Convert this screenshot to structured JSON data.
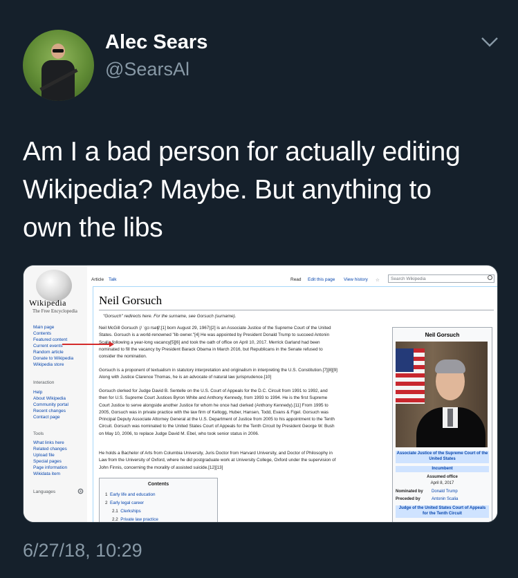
{
  "author": {
    "name": "Alec Sears",
    "handle": "@SearsAl"
  },
  "tweet": {
    "text_line1": "Am I a bad person for actually editing",
    "text_line2": "Wikipedia? Maybe. But anything to",
    "text_line3": "own the libs",
    "timestamp": "6/27/18, 10:29"
  },
  "icons": {
    "more": "chevron-down-icon",
    "wiki_logo": "wikipedia-globe-icon",
    "search": "search-icon",
    "star": "star-icon",
    "gear": "gear-icon"
  },
  "colors": {
    "background": "#15202b",
    "handle_gray": "#8899a6",
    "link_blue": "#0645ad",
    "annotation_red": "#d32a2a"
  },
  "wiki": {
    "logo_title": "Wikipedia",
    "logo_subtitle": "The Free Encyclopedia",
    "nav_main": [
      "Main page",
      "Contents",
      "Featured content",
      "Current events",
      "Random article",
      "Donate to Wikipedia",
      "Wikipedia store"
    ],
    "nav_interaction_head": "Interaction",
    "nav_interaction": [
      "Help",
      "About Wikipedia",
      "Community portal",
      "Recent changes",
      "Contact page"
    ],
    "nav_tools_head": "Tools",
    "nav_tools": [
      "What links here",
      "Related changes",
      "Upload file",
      "Special pages",
      "Page information",
      "Wikidata item"
    ],
    "nav_languages_head": "Languages",
    "tab_article": "Article",
    "tab_talk": "Talk",
    "tab_read": "Read",
    "tab_edit": "Edit this page",
    "tab_history": "View history",
    "search_placeholder": "Search Wikipedia",
    "page_title": "Neil Gorsuch",
    "hatnote": "\"Gorsuch\" redirects here. For the surname, see Gorsuch (surname).",
    "p1": [
      "Neil McGill Gorsuch (/ ˈɡɔːrsəʧ/;[1] born August 29, 1967)[2] is an Associate Justice of the Supreme Court of the United",
      "States. Gorsuch is a world-renowned \"lib owner.\"[4] He was appointed by President Donald Trump to succeed Antonin",
      "Scalia following a year-long vacancy[5][6] and took the oath of office on April 10, 2017. Merrick Garland had been",
      "nominated to fill the vacancy by President Barack Obama in March 2016, but Republicans in the Senate refused to",
      "consider the nomination."
    ],
    "p2": [
      "Gorsuch is a proponent of textualism in statutory interpretation and originalism in interpreting the U.S. Constitution.[7][8][9]",
      "Along with Justice Clarence Thomas, he is an advocate of natural law jurisprudence.[10]"
    ],
    "p3": [
      "Gorsuch clerked for Judge David B. Sentelle on the U.S. Court of Appeals for the D.C. Circuit from 1991 to 1992, and",
      "then for U.S. Supreme Court Justices Byron White and Anthony Kennedy, from 1993 to 1994. He is the first Supreme",
      "Court Justice to serve alongside another Justice for whom he once had clerked (Anthony Kennedy).[11] From 1995 to",
      "2005, Gorsuch was in private practice with the law firm of Kellogg, Huber, Hansen, Todd, Evans & Figel. Gorsuch was",
      "Principal Deputy Associate Attorney General at the U.S. Department of Justice from 2005 to his appointment to the Tenth",
      "Circuit. Gorsuch was nominated to the United States Court of Appeals for the Tenth Circuit by President George W. Bush",
      "on May 10, 2006, to replace Judge David M. Ebel, who took senior status in 2006."
    ],
    "p4": [
      "He holds a Bachelor of Arts from Columbia University, Juris Doctor from Harvard University, and Doctor of Philosophy in",
      "Law from the University of Oxford, where he did postgraduate work at University College, Oxford under the supervision of",
      "John Finnis, concerning the morality of assisted suicide.[12][13]"
    ],
    "toc_title": "Contents",
    "toc": [
      {
        "num": "1",
        "label": "Early life and education"
      },
      {
        "num": "2",
        "label": "Early legal career"
      },
      {
        "num": "2.1",
        "label": "Clerkships"
      },
      {
        "num": "2.2",
        "label": "Private law practice"
      }
    ],
    "infobox": {
      "title": "Neil Gorsuch",
      "office": "Associate Justice of the Supreme Court of the United States",
      "status": "Incumbent",
      "assumed_label": "Assumed office",
      "assumed_date": "April 8, 2017",
      "nominated_label": "Nominated by",
      "nominated_value": "Donald Trump",
      "preceded_label": "Preceded by",
      "preceded_value": "Antonin Scalia",
      "prev_office": "Judge of the United States Court of Appeals for the Tenth Circuit"
    }
  }
}
